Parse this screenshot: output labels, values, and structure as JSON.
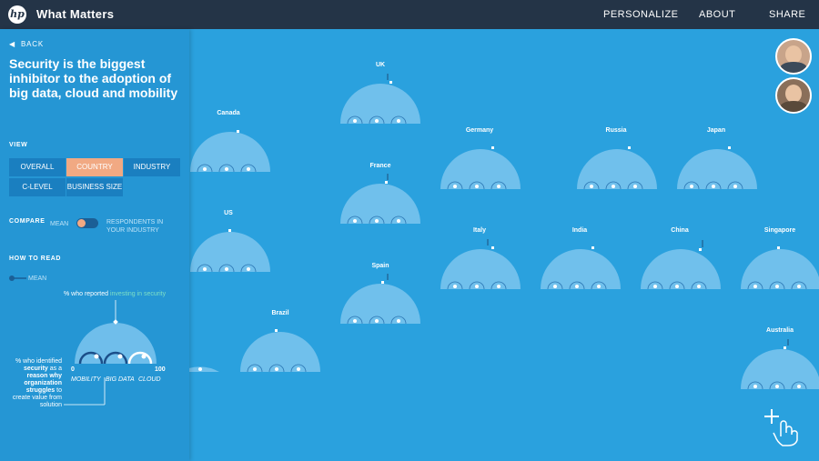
{
  "header": {
    "logo": "hp",
    "title": "What Matters",
    "nav": [
      "PERSONALIZE",
      "ABOUT",
      "SHARE"
    ]
  },
  "sidebar": {
    "back": "BACK",
    "headline": "Security is the biggest inhibitor to the adoption of big data, cloud and mobility",
    "view_label": "VIEW",
    "view_options": [
      "OVERALL",
      "COUNTRY",
      "INDUSTRY",
      "C-LEVEL",
      "BUSINESS SIZE"
    ],
    "view_selected": "COUNTRY",
    "compare_label": "COMPARE",
    "compare_left": "MEAN",
    "compare_right": "RESPONDENTS IN YOUR INDUSTRY",
    "how_to_read": "HOW TO READ",
    "legend_mean": "MEAN",
    "legend_top_prefix": "% who reported ",
    "legend_top_highlight": "investing in security",
    "axis_min": "0",
    "axis_max": "100",
    "categories": [
      "MOBILITY",
      "BIG DATA",
      "CLOUD"
    ],
    "side_note": {
      "line1": "% who identified",
      "bold1": "security",
      "line2": " as a",
      "bold2": "reason why organization struggles",
      "line3": " to create value from solution"
    }
  },
  "countries": [
    "UK",
    "Canada",
    "Germany",
    "Russia",
    "Japan",
    "France",
    "US",
    "Italy",
    "India",
    "China",
    "Singapore",
    "Spain",
    "Brazil",
    "Australia"
  ],
  "colors": {
    "background": "#2aa1de",
    "topbar": "#243447",
    "active": "#f1a983",
    "highlight": "#7ee0c5"
  },
  "icons": [
    "back-chevron-icon",
    "plus-hand-icon",
    "avatar"
  ]
}
